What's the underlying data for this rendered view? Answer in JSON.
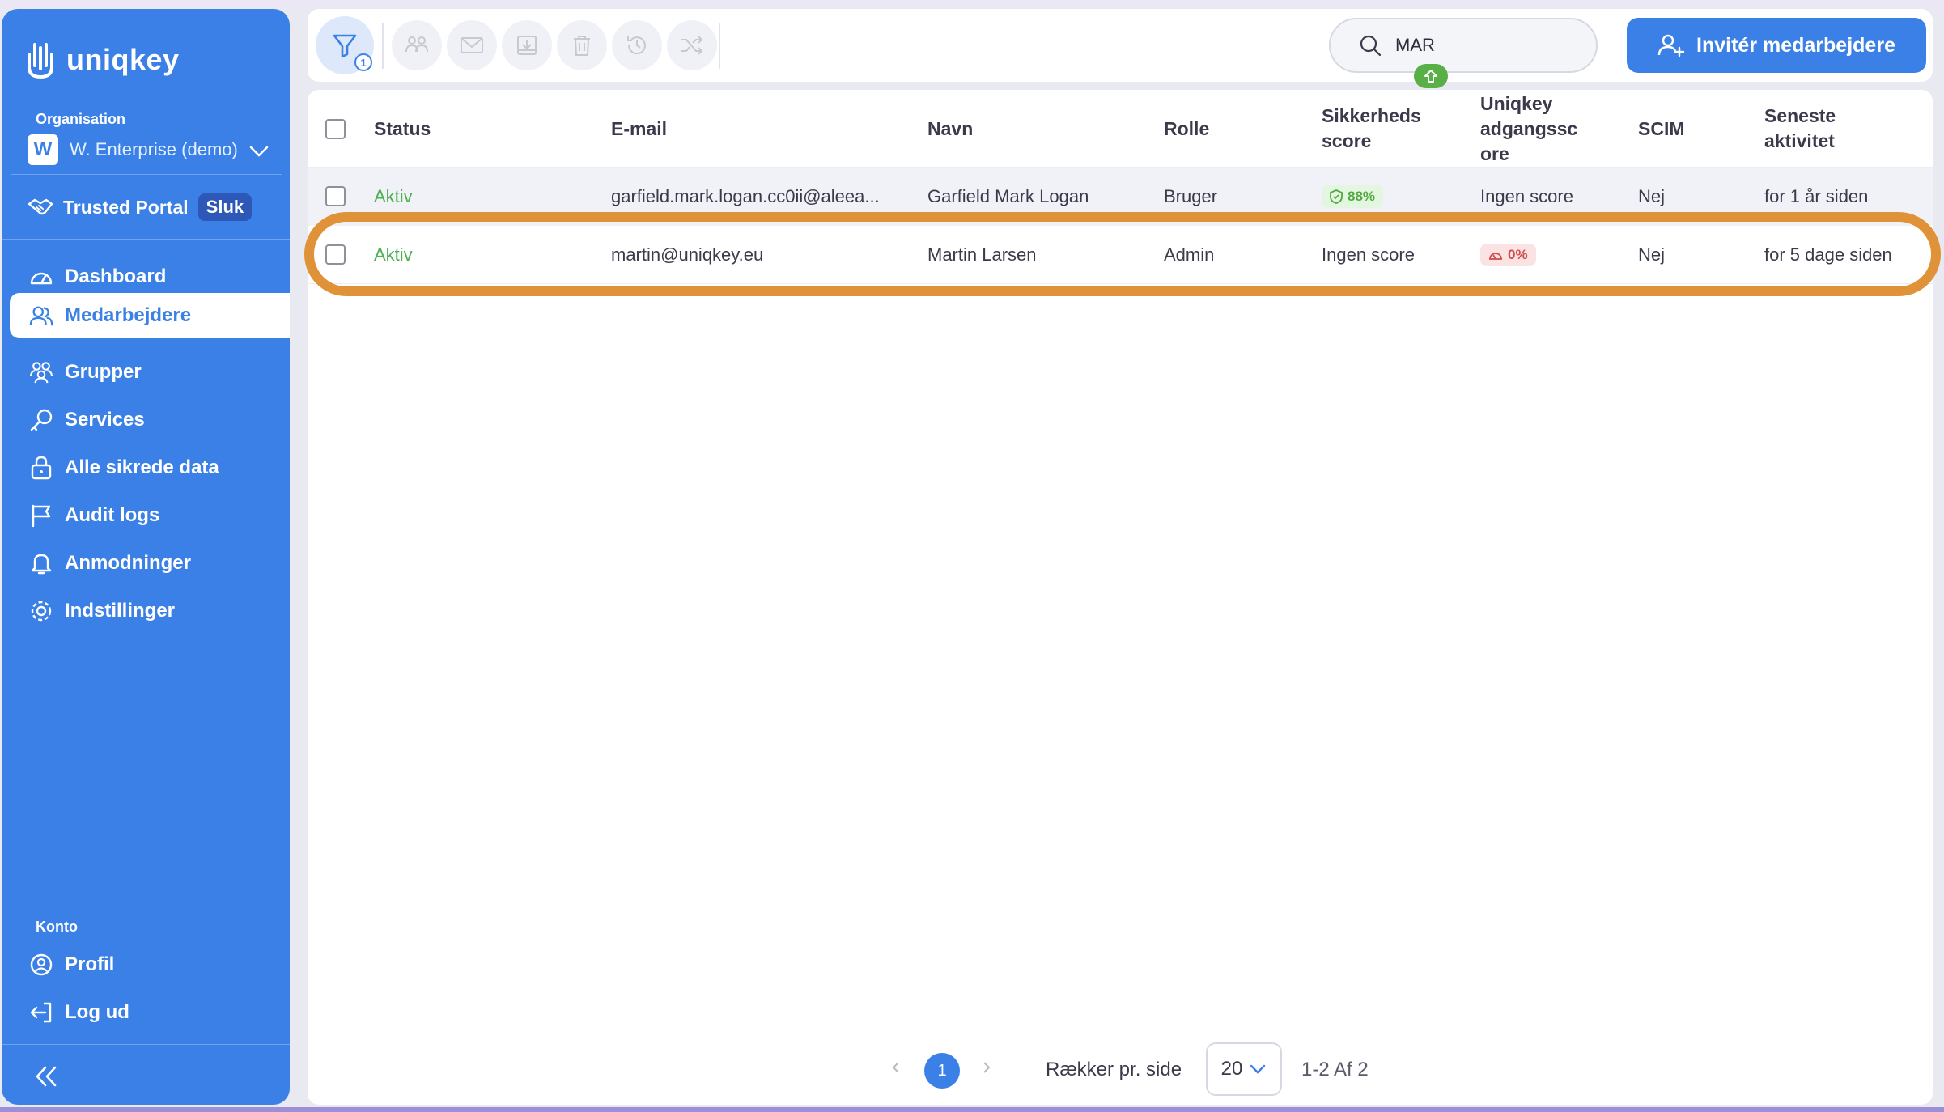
{
  "sidebar": {
    "logo_text": "uniqkey",
    "org_label": "Organisation",
    "org_badge": "W",
    "org_name": "W. Enterprise (demo)",
    "trusted_portal": "Trusted Portal",
    "trusted_toggle": "Sluk",
    "nav": [
      {
        "label": "Dashboard",
        "icon": "dashboard-icon"
      },
      {
        "label": "Medarbejdere",
        "icon": "users-icon",
        "active": true
      },
      {
        "label": "Grupper",
        "icon": "groups-icon"
      },
      {
        "label": "Services",
        "icon": "key-icon"
      },
      {
        "label": "Alle sikrede data",
        "icon": "lock-icon"
      },
      {
        "label": "Audit logs",
        "icon": "flag-icon"
      },
      {
        "label": "Anmodninger",
        "icon": "bell-icon"
      },
      {
        "label": "Indstillinger",
        "icon": "gear-icon"
      }
    ],
    "konto_label": "Konto",
    "account": [
      {
        "label": "Profil",
        "icon": "profile-icon"
      },
      {
        "label": "Log ud",
        "icon": "logout-icon"
      }
    ]
  },
  "toolbar": {
    "filter_count": "1",
    "search_value": "MAR",
    "invite_label": "Invitér medarbejdere"
  },
  "table": {
    "headers": {
      "status": "Status",
      "email": "E-mail",
      "name": "Navn",
      "role": "Rolle",
      "security_score_1": "Sikkerheds",
      "security_score_2": "score",
      "access_score_1": "Uniqkey",
      "access_score_2": "adgangssc",
      "access_score_3": "ore",
      "scim": "SCIM",
      "last_activity_1": "Seneste",
      "last_activity_2": "aktivitet"
    },
    "rows": [
      {
        "status": "Aktiv",
        "email": "garfield.mark.logan.cc0ii@aleea...",
        "name": "Garfield Mark Logan",
        "role": "Bruger",
        "security_score": "88%",
        "access_score": "Ingen score",
        "scim": "Nej",
        "last_activity": "for 1 år siden"
      },
      {
        "status": "Aktiv",
        "email": "martin@uniqkey.eu",
        "name": "Martin Larsen",
        "role": "Admin",
        "security_score": "Ingen score",
        "access_score": "0%",
        "scim": "Nej",
        "last_activity": "for 5 dage siden"
      }
    ]
  },
  "pagination": {
    "current_page": "1",
    "rows_per_page_label": "Rækker pr. side",
    "rows_per_page": "20",
    "range": "1-2 Af 2"
  },
  "colors": {
    "brand": "#3a80e6",
    "highlight": "#e09238",
    "active_status": "#4caf50"
  }
}
